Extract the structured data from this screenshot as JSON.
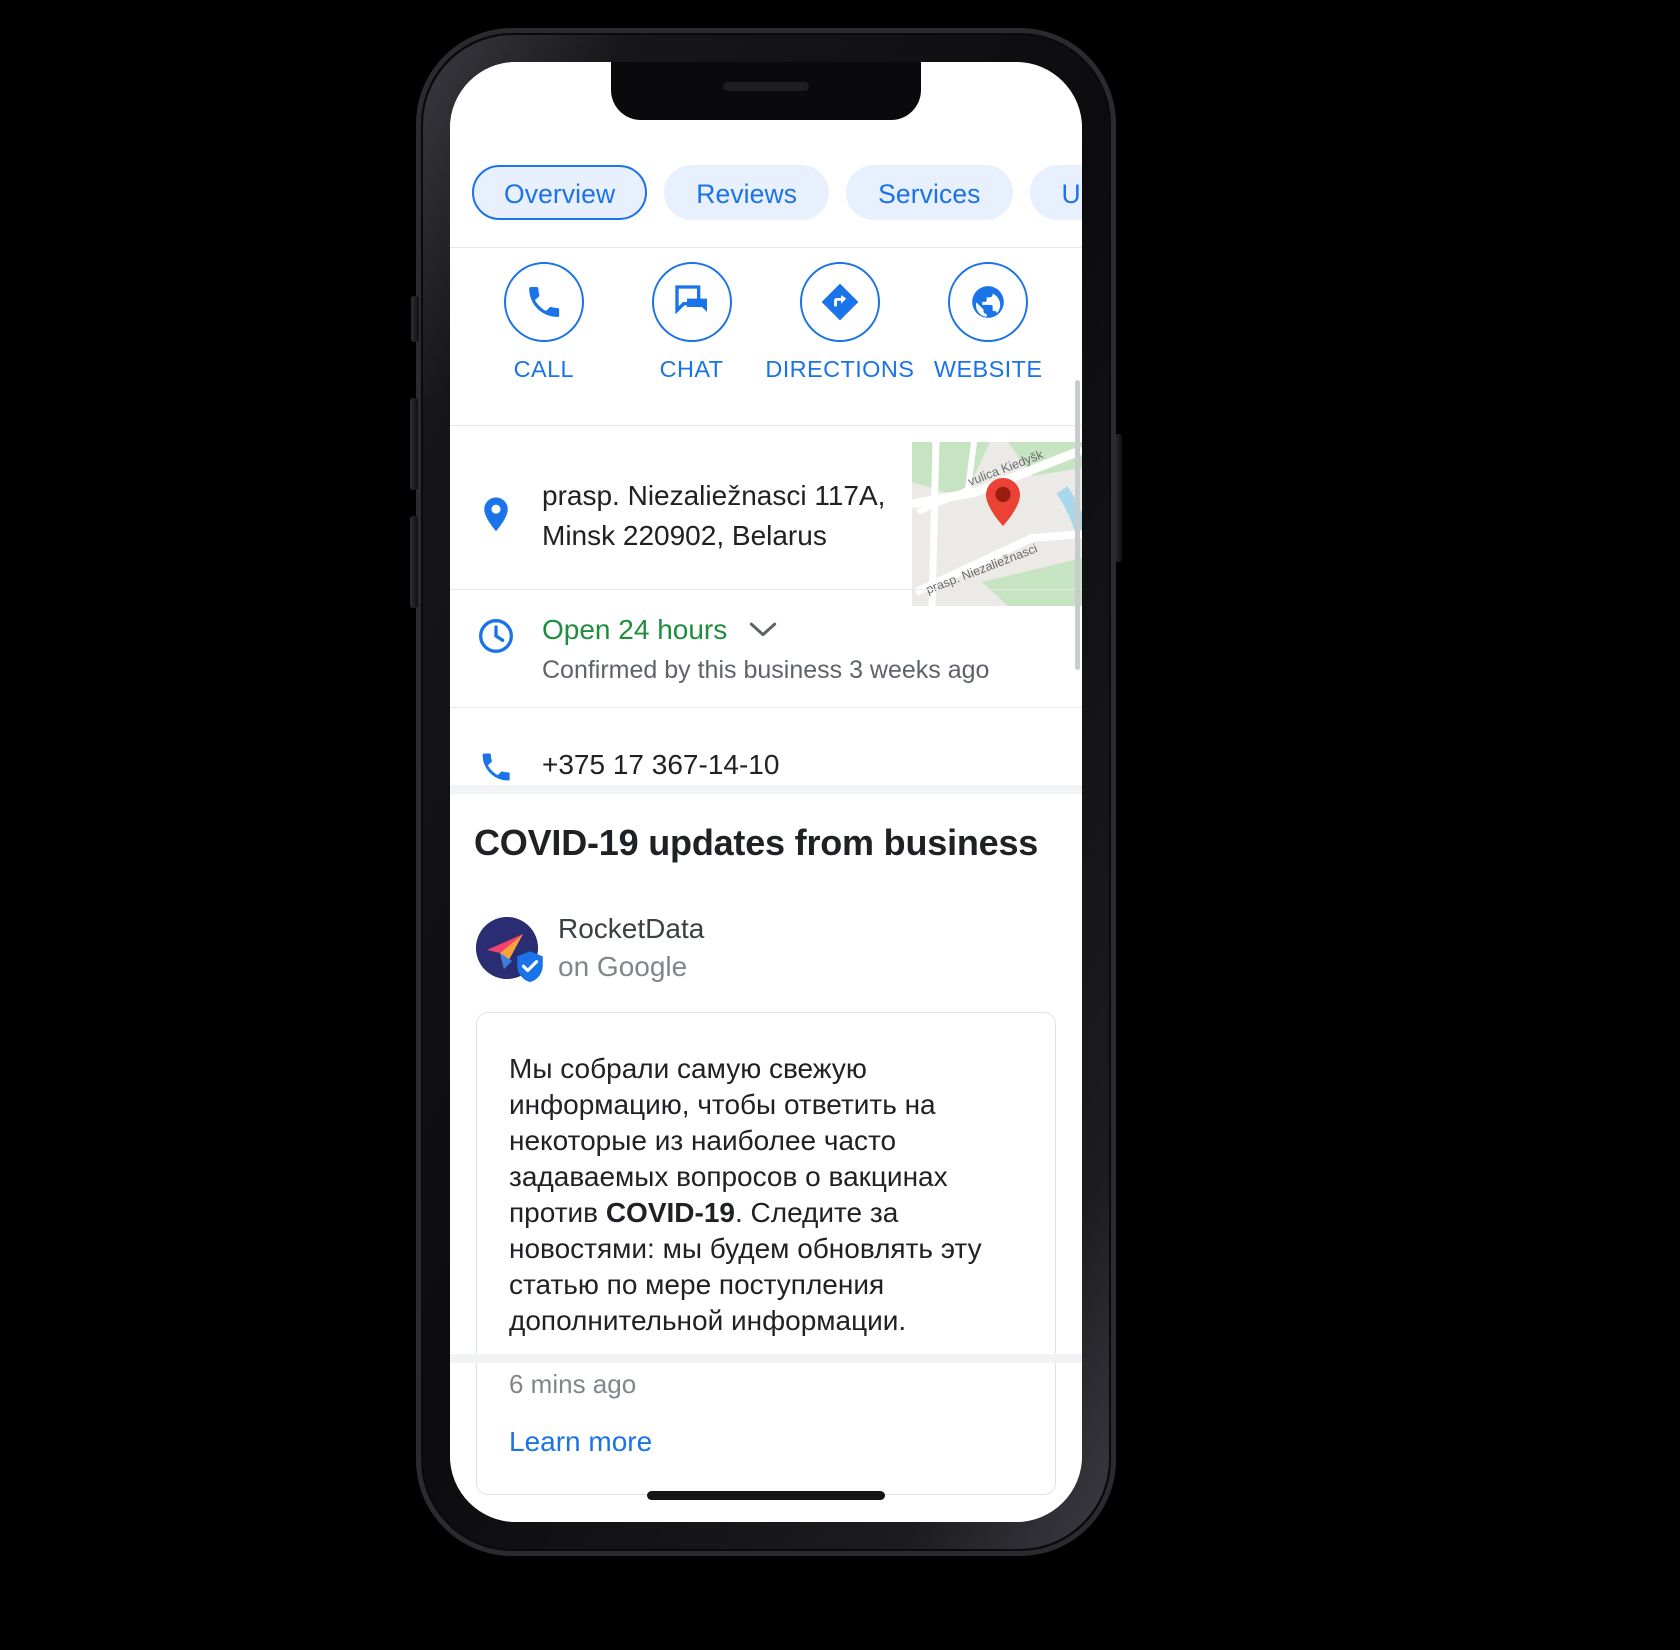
{
  "device": {
    "platform": "smartphone"
  },
  "tabs": [
    {
      "label": "Overview",
      "selected": true
    },
    {
      "label": "Reviews",
      "selected": false
    },
    {
      "label": "Services",
      "selected": false
    },
    {
      "label": "Updates",
      "selected": false
    }
  ],
  "actions": [
    {
      "label": "CALL",
      "icon": "phone-icon"
    },
    {
      "label": "CHAT",
      "icon": "chat-icon"
    },
    {
      "label": "DIRECTIONS",
      "icon": "directions-icon"
    },
    {
      "label": "WEBSITE",
      "icon": "globe-icon"
    }
  ],
  "address": {
    "line1": "prasp. Niezaliežnasci 117A,",
    "line2": "Minsk 220902, Belarus",
    "icon": "location-pin-icon",
    "map_labels": {
      "street_top": "vulica Kiedyšk",
      "street_bottom": "prasp. Niezaliežnasci"
    }
  },
  "hours": {
    "status": "Open 24 hours",
    "confirmed": "Confirmed by this business 3 weeks ago",
    "icon": "clock-icon",
    "expand_icon": "chevron-down-icon"
  },
  "phone": {
    "number": "+375 17 367-14-10",
    "icon": "phone-icon"
  },
  "covid": {
    "heading": "COVID-19 updates from business",
    "author_name": "RocketData",
    "author_source": "on Google",
    "badge_icon": "verified-shield-icon",
    "post_part1": "Мы собрали самую свежую информацию, чтобы ответить на некоторые из наиболее часто задаваемых вопросов о вакцинах против ",
    "post_bold": "COVID-19",
    "post_part2": ". Следите за новостями: мы будем обновлять эту статью по мере поступления дополнительной информации.",
    "time": "6 mins ago",
    "link": "Learn more"
  },
  "colors": {
    "accent_blue": "#1a73e8",
    "chip_bg": "#e8f0fe",
    "open_green": "#1e8e3e",
    "text_primary": "#202124",
    "text_secondary": "#5f6368",
    "text_muted": "#80868b",
    "marker_red": "#ea4335",
    "avatar_navy": "#2b2d73"
  }
}
